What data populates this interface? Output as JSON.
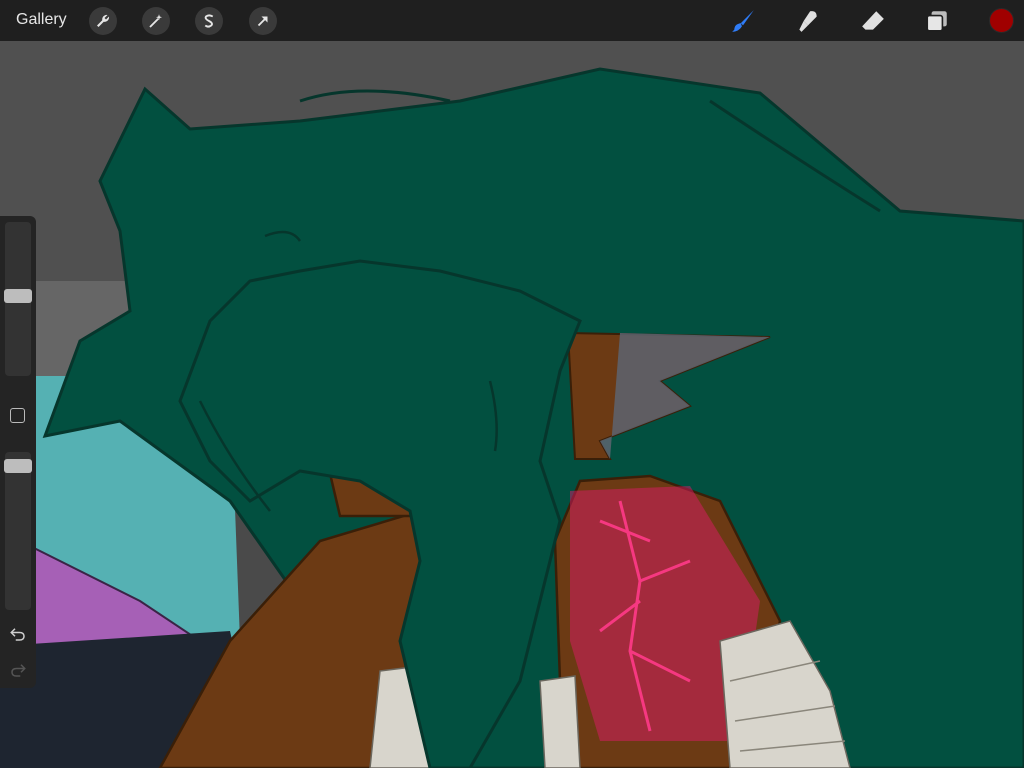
{
  "topbar": {
    "gallery_label": "Gallery",
    "tools_left": [
      {
        "name": "actions",
        "icon": "wrench-icon"
      },
      {
        "name": "adjustments",
        "icon": "magic-wand-icon"
      },
      {
        "name": "selection",
        "icon": "selection-s-icon"
      },
      {
        "name": "transform",
        "icon": "transform-arrow-icon"
      }
    ],
    "tools_right": [
      {
        "name": "brush",
        "icon": "brush-icon",
        "active": true
      },
      {
        "name": "smudge",
        "icon": "smudge-icon",
        "active": false
      },
      {
        "name": "eraser",
        "icon": "eraser-icon",
        "active": false
      },
      {
        "name": "layers",
        "icon": "layers-icon",
        "active": false
      }
    ],
    "current_color": "#a00000",
    "active_tool_color": "#2f7cf6"
  },
  "sidebar": {
    "brush_size_level": 0.52,
    "opacity_level": 0.05,
    "modify_button_icon": "square-icon",
    "undo_icon": "undo-icon",
    "redo_icon": "redo-icon"
  },
  "canvas": {
    "palette": {
      "background_gray": "#4a4a4a",
      "hair": "#025040",
      "skin": "#6c3a14",
      "glow": "#e8186f",
      "teal": "#55b1b3",
      "purple": "#a660b6",
      "navy": "#1e2530",
      "bandage": "#d8d5cc"
    }
  }
}
